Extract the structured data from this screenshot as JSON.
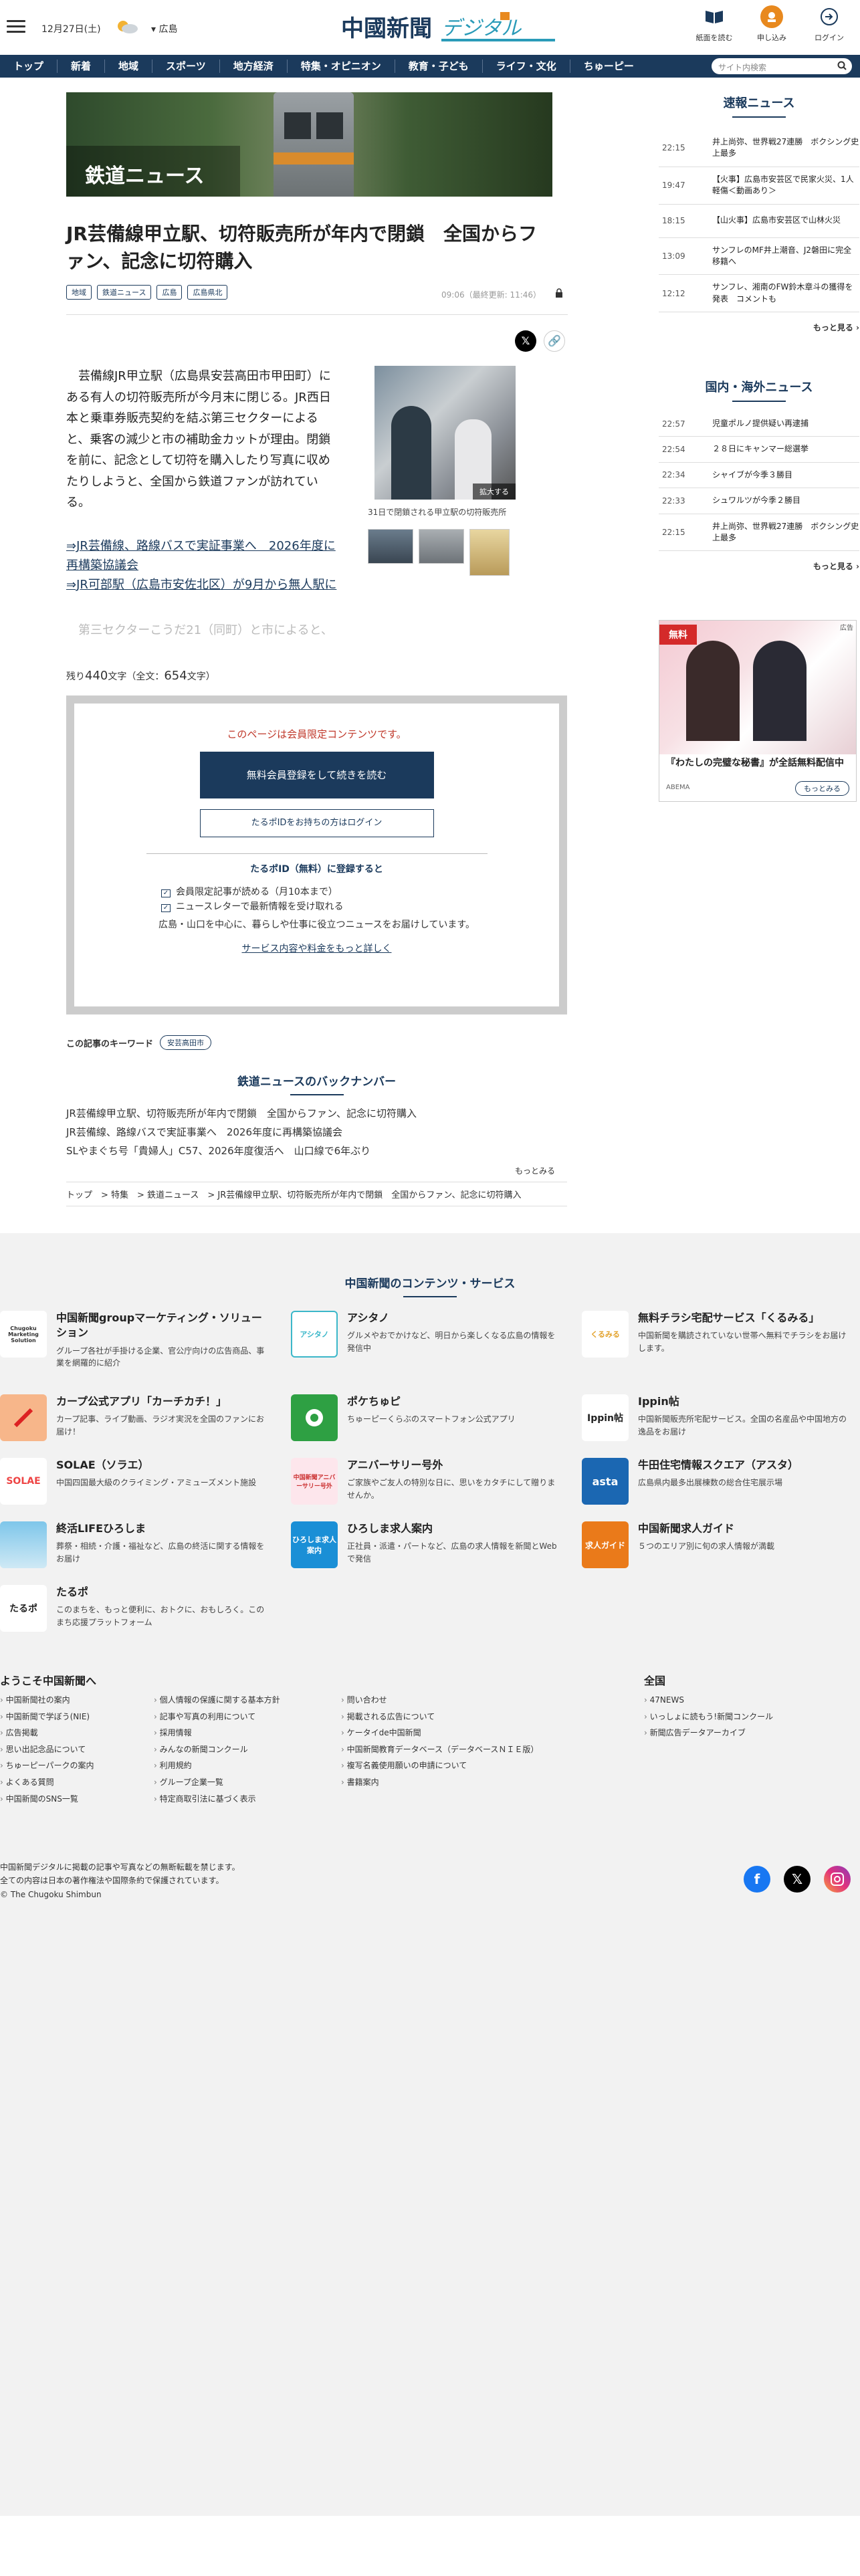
{
  "header": {
    "date": "12月27日(土)",
    "region": "広島",
    "logo_main": "中國新聞",
    "logo_sub": "デジタル",
    "icons": [
      {
        "label": "紙面を読む"
      },
      {
        "label": "申し込み"
      },
      {
        "label": "ログイン"
      }
    ]
  },
  "nav": {
    "items": [
      "トップ",
      "新着",
      "地域",
      "スポーツ",
      "地方経済",
      "特集・オピニオン",
      "教育・子ども",
      "ライフ・文化",
      "ちゅーピー"
    ],
    "search_placeholder": "サイト内検索"
  },
  "article": {
    "hero_label": "鉄道ニュース",
    "title": "JR芸備線甲立駅、切符販売所が年内で閉鎖　全国からファン、記念に切符購入",
    "tags": [
      "地域",
      "鉄道ニュース",
      "広島",
      "広島県北"
    ],
    "date": "09:06（最終更新: 11:46）",
    "lead": "　芸備線JR甲立駅（広島県安芸高田市甲田町）にある有人の切符販売所が今月末に閉じる。JR西日本と乗車券販売契約を結ぶ第三セクターによると、乗客の減少と市の補助金カットが理由。閉鎖を前に、記念として切符を購入したり写真に収めたりしようと、全国から鉄道ファンが訪れている。",
    "link1": "⇒JR芸備線、路線バスで実証事業へ　2026年度に再構築協議会",
    "link2": "⇒JR可部駅（広島市安佐北区）が9月から無人駅に",
    "faded": "　第三セクターこうだ21（同町）と市によると、",
    "photo_zoom": "拡大する",
    "photo_caption": "31日で閉鎖される甲立駅の切符販売所",
    "remain_prefix": "残り",
    "remain_count": "440",
    "remain_mid": "文字（全文：",
    "total_count": "654",
    "remain_suffix": "文字）"
  },
  "paywall": {
    "message": "このページは会員限定コンテンツです。",
    "register_button": "無料会員登録をして続きを読む",
    "login_button": "たるポIDをお持ちの方はログイン",
    "register_title": "たるポID（無料）に登録すると",
    "benefit1": "会員限定記事が読める（月10本まで）",
    "benefit2": "ニュースレターで最新情報を受け取れる",
    "benefit3": "広島・山口を中心に、暮らしや仕事に役立つニュースをお届けしています。",
    "more_link": "サービス内容や料金をもっと詳しく"
  },
  "keywords": {
    "label": "この記事のキーワード",
    "tag": "安芸高田市"
  },
  "backnumber": {
    "title": "鉄道ニュースのバックナンバー",
    "items": [
      "JR芸備線甲立駅、切符販売所が年内で閉鎖　全国からファン、記念に切符購入",
      "JR芸備線、路線バスで実証事業へ　2026年度に再構築協議会",
      "SLやまぐち号「貴婦人」C57、2026年度復活へ　山口線で6年ぶり"
    ],
    "more": "もっとみる",
    "breadcrumb": "トップ　>  特集　>  鉄道ニュース　>  JR芸備線甲立駅、切符販売所が年内で閉鎖　全国からファン、記念に切符購入"
  },
  "sidebar": {
    "breaking_title": "速報ニュース",
    "breaking": [
      {
        "time": "22:15",
        "text": "井上尚弥、世界戦27連勝　ボクシング史上最多"
      },
      {
        "time": "19:47",
        "text": "【火事】広島市安芸区で民家火災、1人軽傷＜動画あり＞"
      },
      {
        "time": "18:15",
        "text": "【山火事】広島市安芸区で山林火災"
      },
      {
        "time": "13:09",
        "text": "サンフレのMF井上潮音、J2磐田に完全移籍へ"
      },
      {
        "time": "12:12",
        "text": "サンフレ、湘南のFW鈴木章斗の獲得を発表　コメントも"
      }
    ],
    "more": "もっと見る",
    "national_title": "国内・海外ニュース",
    "national": [
      {
        "time": "22:57",
        "text": "児童ポルノ提供疑い再逮捕"
      },
      {
        "time": "22:54",
        "text": "２８日にキャンマー総選挙"
      },
      {
        "time": "22:34",
        "text": "シャイブが今季３勝目"
      },
      {
        "time": "22:33",
        "text": "シュワルツが今季２勝目"
      },
      {
        "time": "22:15",
        "text": "井上尚弥、世界戦27連勝　ボクシング史上最多"
      }
    ],
    "more2": "もっと見る",
    "ad": {
      "label": "広告",
      "badge": "無料",
      "title": "『わたしの完璧な秘書』が全話無料配信中",
      "source": "ABEMA",
      "cta": "もっとみる"
    }
  },
  "services": {
    "title": "中国新聞のコンテンツ・サービス",
    "items": [
      {
        "name": "中国新聞groupマーケティング・ソリューション",
        "desc": "グループ各社が手掛ける企業、官公庁向けの広告商品、事業を網羅的に紹介",
        "logo": "Chugoku Marketing Solution"
      },
      {
        "name": "アシタノ",
        "desc": "グルメやおでかけなど、明日から楽しくなる広島の情報を発信中",
        "logo": "アシタノ"
      },
      {
        "name": "無料チラシ宅配サービス「くるみる」",
        "desc": "中国新聞を購読されていない世帯へ無料でチラシをお届けします。",
        "logo": "くるみる"
      },
      {
        "name": "カープ公式アプリ「カーチカチ！」",
        "desc": "カープ記事、ライブ動画、ラジオ実況を全国のファンにお届け！",
        "logo": ""
      },
      {
        "name": "ポケちゅピ",
        "desc": "ちゅーピーくらぶのスマートフォン公式アプリ",
        "logo": ""
      },
      {
        "name": "Ippin帖",
        "desc": "中国新聞販売所宅配サービス。全国の名産品や中国地方の逸品をお届け",
        "logo": "Ippin帖"
      },
      {
        "name": "SOLAE（ソラエ）",
        "desc": "中国四国最大級のクライミング・アミューズメント施設",
        "logo": "SOLAE"
      },
      {
        "name": "アニバーサリー号外",
        "desc": "ご家族やご友人の特別な日に、思いをカタチにして贈りませんか。",
        "logo": "中国新聞アニバーサリー号外"
      },
      {
        "name": "牛田住宅情報スクエア（アスタ）",
        "desc": "広島県内最多出展棟数の総合住宅展示場",
        "logo": "asta"
      },
      {
        "name": "終活LIFEひろしま",
        "desc": "葬祭・相続・介護・福祉など、広島の終活に関する情報をお届け",
        "logo": ""
      },
      {
        "name": "ひろしま求人案内",
        "desc": "正社員・派遣・パートなど、広島の求人情報を新聞とWebで発信",
        "logo": "ひろしま求人案内"
      },
      {
        "name": "中国新聞求人ガイド",
        "desc": "５つのエリア別に旬の求人情報が満載",
        "logo": "求人ガイド"
      },
      {
        "name": "たるポ",
        "desc": "このまちを、もっと便利に、おトクに、おもしろく。このまち応援プラットフォーム",
        "logo": "たるポ"
      }
    ]
  },
  "footer": {
    "welcome": "ようこそ中国新聞へ",
    "col1": [
      "中国新聞社の案内",
      "中国新聞で学ぼう(NIE)",
      "広告掲載",
      "思い出記念品について",
      "ちゅーピーパークの案内",
      "よくある質問",
      "中国新聞のSNS一覧"
    ],
    "col2": [
      "個人情報の保護に関する基本方針",
      "記事や写真の利用について",
      "採用情報",
      "みんなの新聞コンクール",
      "利用規約",
      "グループ企業一覧",
      "特定商取引法に基づく表示"
    ],
    "col3": [
      "問い合わせ",
      "掲載される広告について",
      "ケータイde中国新聞",
      "中国新聞教育データベース（データベースＮＩＥ版）",
      "複写名義使用願いの申請について",
      "書籍案内"
    ],
    "national_title": "全国",
    "col4": [
      "47NEWS",
      "いっしょに読もう!新聞コンクール",
      "新聞広告データアーカイブ"
    ],
    "notice1": "中国新聞デジタルに掲載の記事や写真などの無断転載を禁じます。",
    "notice2": "全ての内容は日本の著作権法や国際条約で保護されています。",
    "copyright": "© The Chugoku Shimbun"
  },
  "colors": {
    "navy": "#1b3a5c",
    "red": "#c0392b",
    "orange": "#e8891e"
  }
}
